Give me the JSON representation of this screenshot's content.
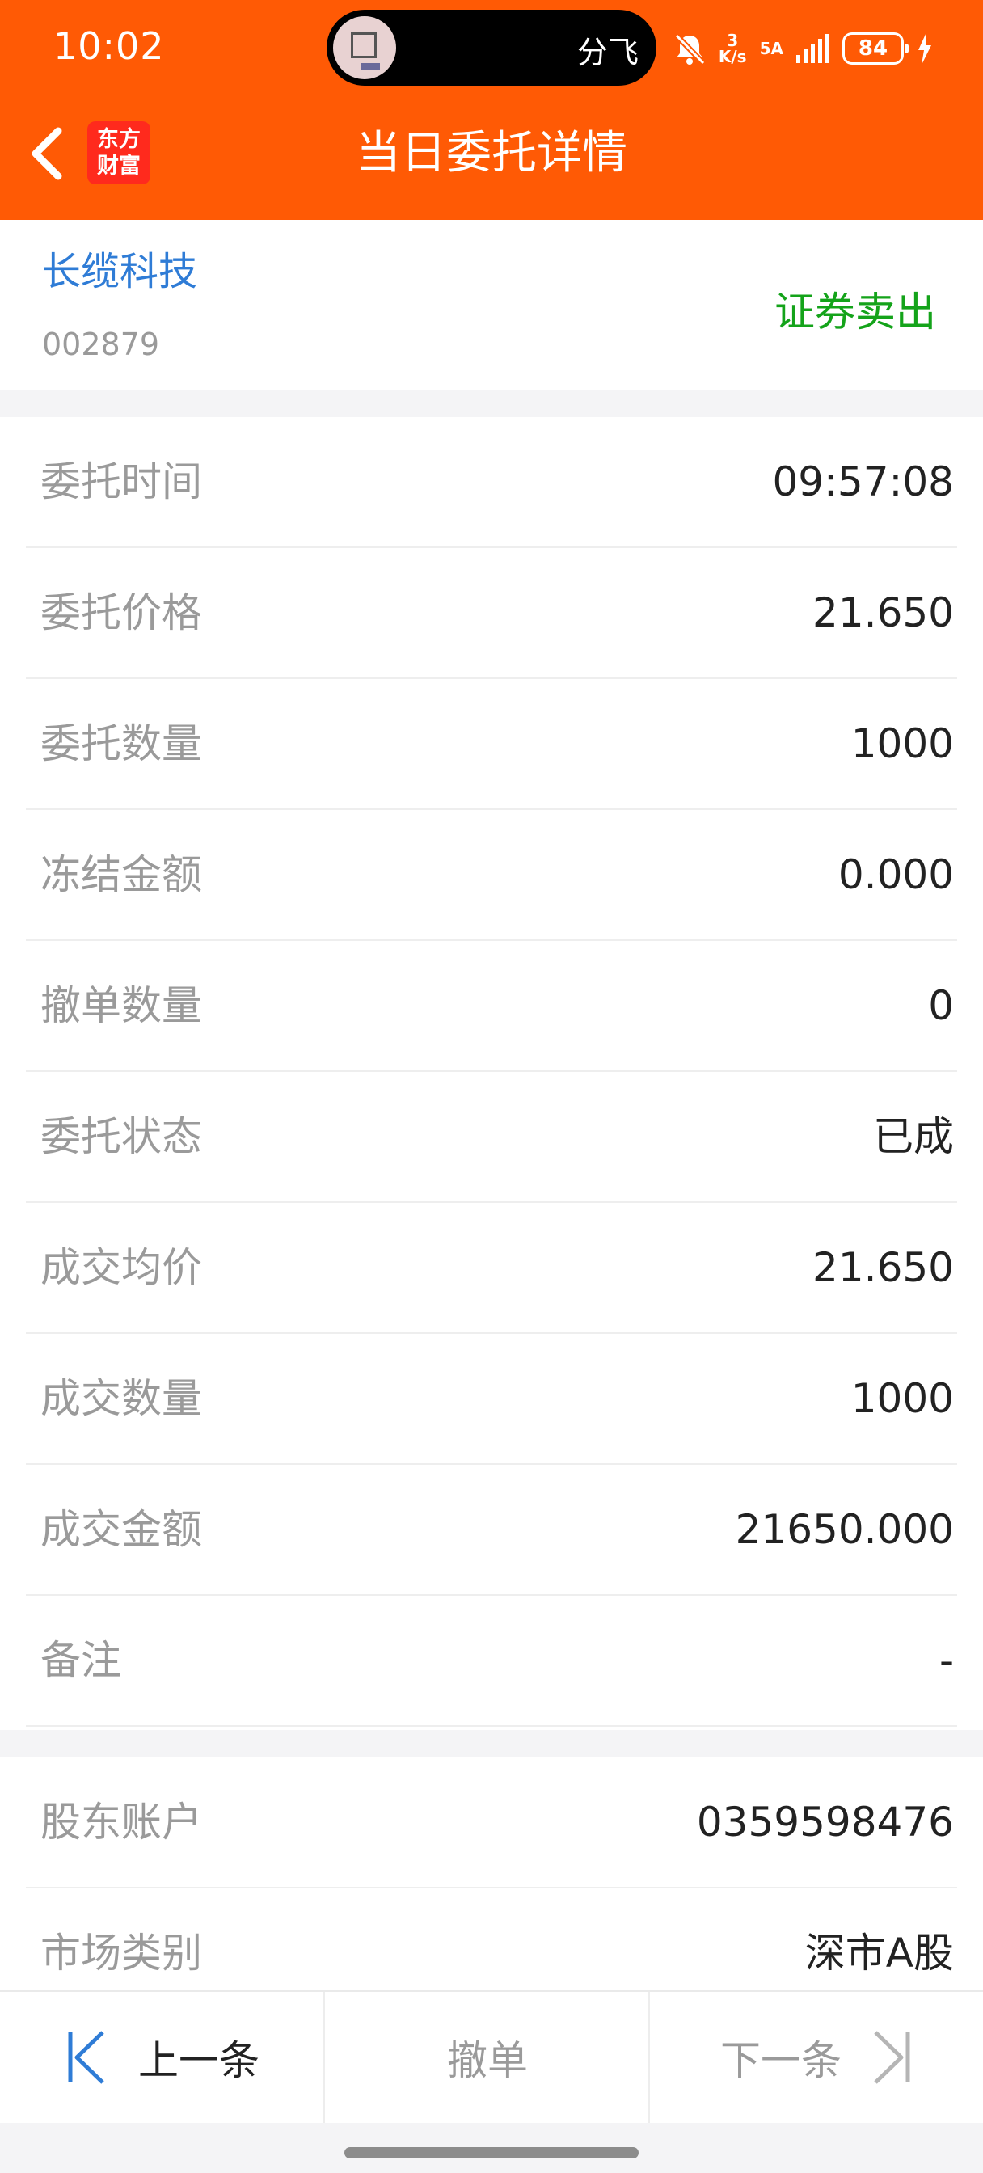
{
  "status_bar": {
    "time": "10:02",
    "island_text": "分飞",
    "net_speed_value": "3",
    "net_speed_unit": "K/s",
    "network": "5A",
    "battery": "84"
  },
  "header": {
    "logo_line1": "东方",
    "logo_line2": "财富",
    "title": "当日委托详情"
  },
  "stock": {
    "name": "长缆科技",
    "code": "002879",
    "order_type": "证券卖出"
  },
  "details": [
    {
      "label": "委托时间",
      "value": "09:57:08"
    },
    {
      "label": "委托价格",
      "value": "21.650"
    },
    {
      "label": "委托数量",
      "value": "1000"
    },
    {
      "label": "冻结金额",
      "value": "0.000"
    },
    {
      "label": "撤单数量",
      "value": "0"
    },
    {
      "label": "委托状态",
      "value": "已成"
    },
    {
      "label": "成交均价",
      "value": "21.650"
    },
    {
      "label": "成交数量",
      "value": "1000"
    },
    {
      "label": "成交金额",
      "value": "21650.000"
    },
    {
      "label": "备注",
      "value": "-"
    }
  ],
  "account": [
    {
      "label": "股东账户",
      "value": "0359598476"
    },
    {
      "label": "市场类别",
      "value": "深市A股"
    }
  ],
  "bottom_bar": {
    "prev_label": "上一条",
    "cancel_label": "撤单",
    "next_label": "下一条"
  },
  "colors": {
    "header_bg": "#ff5a05",
    "stock_name": "#2f7cd6",
    "sell": "#14a31a",
    "nav_active": "#2f7cd6"
  }
}
